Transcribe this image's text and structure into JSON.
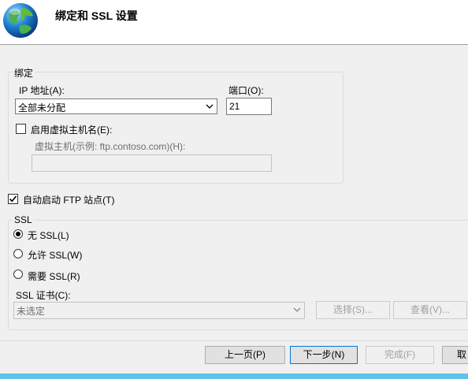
{
  "header": {
    "title": "绑定和 SSL 设置",
    "icon": "globe-icon"
  },
  "binding": {
    "group_title": "绑定",
    "ip_label": "IP 地址(A):",
    "ip_value": "全部未分配",
    "port_label": "端口(O):",
    "port_value": "21",
    "virtual_host_checkbox_label": "启用虚拟主机名(E):",
    "virtual_host_checked": false,
    "virtual_host_label": "虚拟主机(示例: ftp.contoso.com)(H):",
    "virtual_host_value": ""
  },
  "auto_start": {
    "label": "自动启动 FTP 站点(T)",
    "checked": true
  },
  "ssl": {
    "group_title": "SSL",
    "options": [
      {
        "label": "无 SSL(L)",
        "selected": true
      },
      {
        "label": "允许 SSL(W)",
        "selected": false
      },
      {
        "label": "需要 SSL(R)",
        "selected": false
      }
    ],
    "cert_label": "SSL 证书(C):",
    "cert_value": "未选定",
    "select_button": "选择(S)...",
    "view_button": "查看(V)..."
  },
  "footer": {
    "prev_button": "上一页(P)",
    "next_button": "下一步(N)",
    "finish_button": "完成(F)",
    "cancel_button": "取"
  },
  "colors": {
    "accent": "#0078d7",
    "bottom_bar": "#5fc3e8"
  }
}
